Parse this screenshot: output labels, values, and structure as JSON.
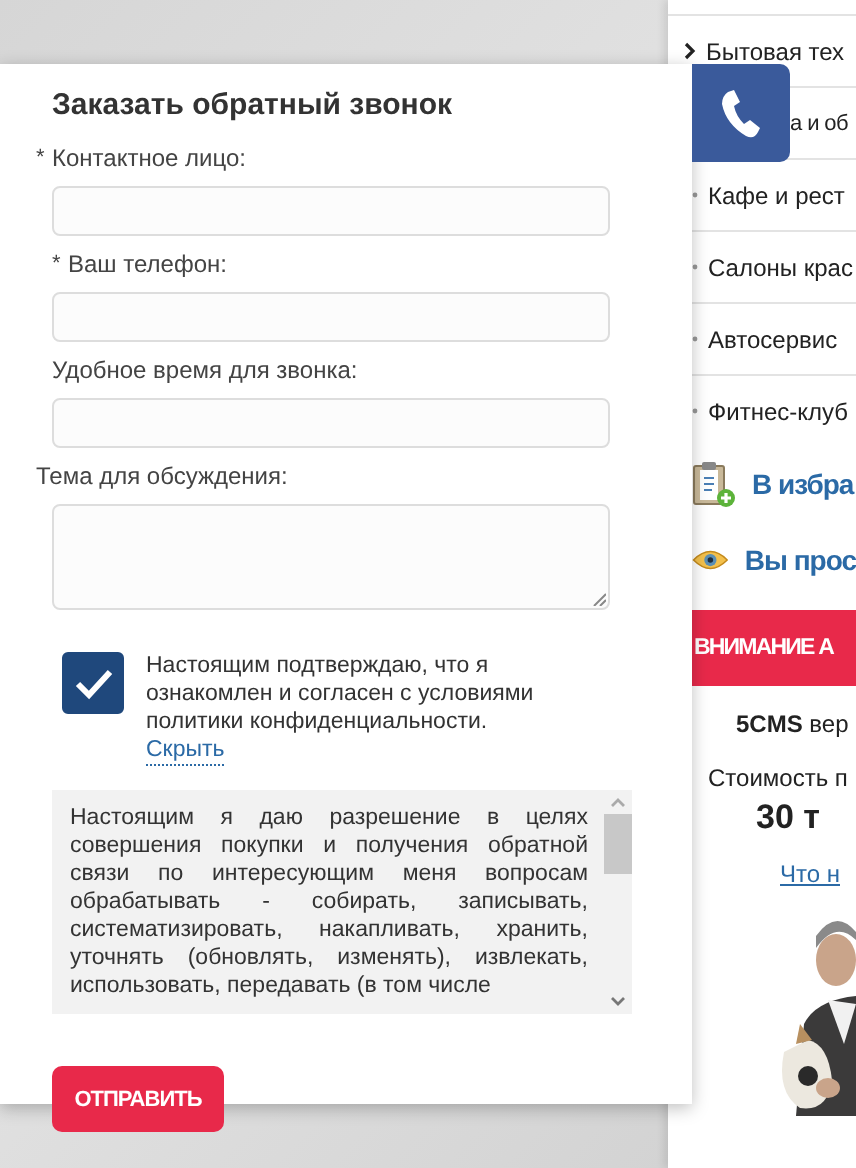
{
  "sidebar": {
    "menu": [
      {
        "label": "Бытовая тех",
        "kind": "chevron"
      },
      {
        "label": "а и об",
        "kind": "clipped"
      },
      {
        "label": "Кафе и рест",
        "kind": "bullet"
      },
      {
        "label": "Салоны крас",
        "kind": "bullet"
      },
      {
        "label": "Автосервис",
        "kind": "bullet"
      },
      {
        "label": "Фитнес-клуб",
        "kind": "bullet"
      }
    ],
    "links": [
      {
        "label": "В избра",
        "kind": "favorites"
      },
      {
        "label": "Вы прос",
        "kind": "viewed"
      }
    ],
    "alert": "ВНИМАНИЕ А",
    "version": "**5CMS** вер",
    "price_label": "Стоимость п",
    "price": "30 т",
    "more_link": "Что н"
  },
  "modal": {
    "title": "Заказать обратный звонок",
    "fields": [
      {
        "label": "Контактное лицо:",
        "required": true,
        "kind": "input"
      },
      {
        "label": "Ваш телефон:",
        "required": true,
        "kind": "input"
      },
      {
        "label": "Удобное время для звонка:",
        "required": false,
        "kind": "input"
      },
      {
        "label": "Тема для обсуждения:",
        "required": false,
        "kind": "textarea"
      }
    ],
    "required_mark": "*",
    "consent": {
      "checked": true,
      "text": "Настоящим подтверждаю, что я ознакомлен и согласен с условиями политики конфиденциальности.",
      "link": "Скрыть"
    },
    "terms": "Настоящим я даю разрешение в целях совершения покупки и получения обратной связи по интересующим меня вопросам обрабатывать - собирать, записывать, систематизировать, накапливать, хранить, уточнять (обновлять, изменять), извлекать, использовать, передавать (в том числе",
    "submit": "ОТПРАВИТЬ"
  },
  "call_button": {
    "kind": "phone"
  }
}
